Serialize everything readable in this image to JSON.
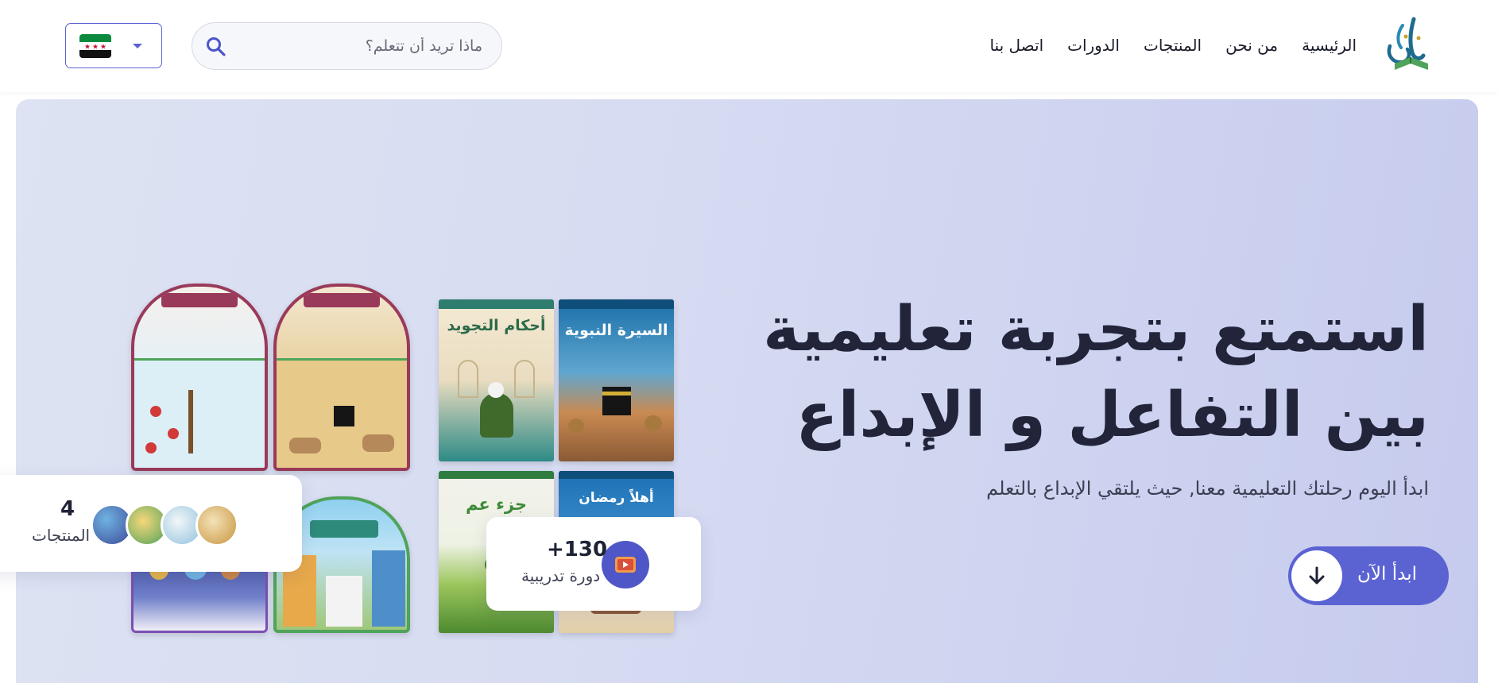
{
  "header": {
    "nav": [
      {
        "label": "الرئيسية"
      },
      {
        "label": "من نحن"
      },
      {
        "label": "المنتجات"
      },
      {
        "label": "الدورات"
      },
      {
        "label": "اتصل بنا"
      }
    ],
    "search": {
      "placeholder": "ماذا تريد أن تتعلم؟"
    },
    "language": {
      "flag_icon": "syria-flag-icon"
    }
  },
  "hero": {
    "headline_line1": "استمتع بتجربة تعليمية",
    "headline_line2": "بين التفاعل و الإبداع",
    "subtitle": "ابدأ اليوم رحلتك التعليمية معنا, حيث يلتقي الإبداع بالتعلم",
    "cta_label": "ابدأ الآن"
  },
  "books": {
    "seerah": "السيرة النبوية",
    "tajweed": "أحكام التجويد",
    "ramadan": "أهلاً رمضان",
    "juz_amma": "جزء عم"
  },
  "stats": {
    "courses": {
      "number": "+130",
      "label": "دورة تدريبية"
    },
    "products": {
      "number": "4",
      "label": "المنتجات"
    }
  },
  "colors": {
    "accent": "#5b63d3",
    "hero_bg": "#d3d8f1"
  }
}
